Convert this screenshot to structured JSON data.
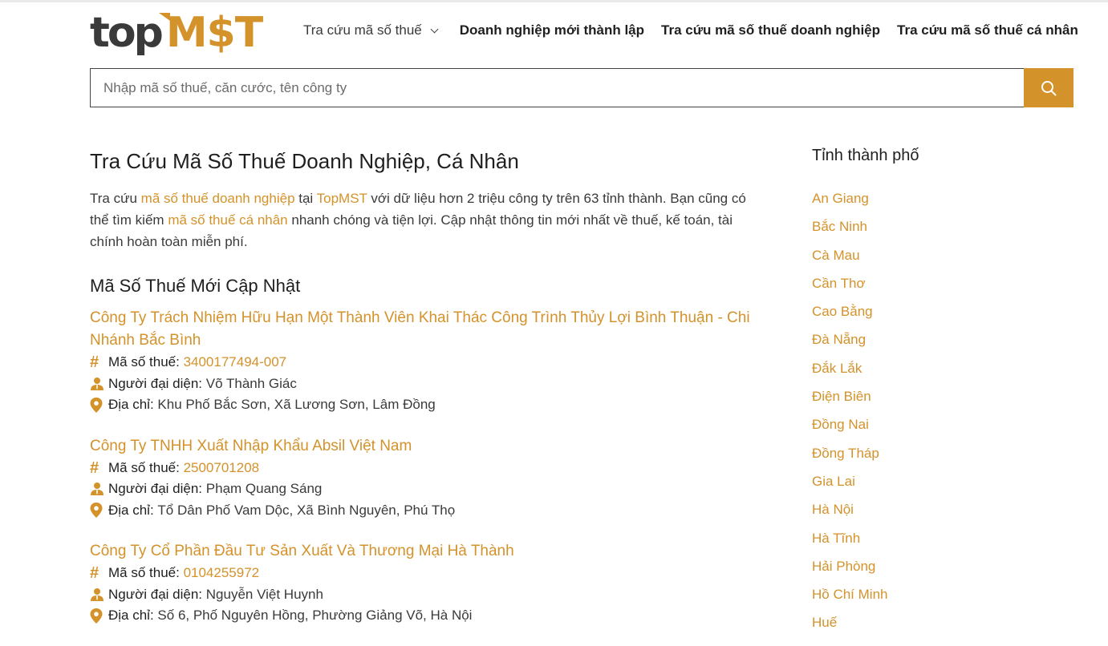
{
  "brand": {
    "logo_top": "top",
    "logo_mst": "M$T",
    "accent_color": "#d4922b"
  },
  "nav": {
    "item1": "Tra cứu mã số thuế",
    "item2": "Doanh nghiệp mới thành lập",
    "item3": "Tra cứu mã số thuế doanh nghiệp",
    "item4": "Tra cứu mã số thuế cá nhân"
  },
  "search": {
    "placeholder": "Nhập mã số thuế, căn cước, tên công ty",
    "icon": "search-icon"
  },
  "main": {
    "title": "Tra Cứu Mã Số Thuế Doanh Nghiệp, Cá Nhân",
    "intro": {
      "p1": "Tra cứu ",
      "link1": "mã số thuế doanh nghiệp",
      "p2": " tại ",
      "link2": "TopMST",
      "p3": " với dữ liệu hơn 2 triệu công ty trên 63 tỉnh thành. Bạn cũng có thể tìm kiếm ",
      "link3": "mã số thuế cá nhân",
      "p4": " nhanh chóng và tiện lợi. Cập nhật thông tin mới nhất về thuế, kế toán, tài chính hoàn toàn miễn phí."
    },
    "section_title": "Mã Số Thuế Mới Cập Nhật",
    "labels": {
      "tax": "Mã số thuế:",
      "rep": "Người đại diện:",
      "addr": "Địa chỉ:"
    },
    "companies": [
      {
        "name": "Công Ty Trách Nhiệm Hữu Hạn Một Thành Viên Khai Thác Công Trình Thủy Lợi Bình Thuận - Chi Nhánh Bắc Bình",
        "tax": "3400177494-007",
        "rep": "Võ Thành Giác",
        "addr": "Khu Phố Bắc Sơn, Xã Lương Sơn, Lâm Đồng"
      },
      {
        "name": "Công Ty TNHH Xuất Nhập Khẩu Absil Việt Nam",
        "tax": "2500701208",
        "rep": "Phạm Quang Sáng",
        "addr": "Tổ Dân Phố Vam Dộc, Xã Bình Nguyên, Phú Thọ"
      },
      {
        "name": "Công Ty Cổ Phần Đầu Tư Sản Xuất Và Thương Mại Hà Thành",
        "tax": "0104255972",
        "rep": "Nguyễn Việt Huynh",
        "addr": "Số 6, Phố Nguyên Hồng, Phường Giảng Võ, Hà Nội"
      }
    ]
  },
  "sidebar": {
    "title": "Tỉnh thành phố",
    "provinces": [
      "An Giang",
      "Bắc Ninh",
      "Cà Mau",
      "Cần Thơ",
      "Cao Bằng",
      "Đà Nẵng",
      "Đắk Lắk",
      "Điện Biên",
      "Đồng Nai",
      "Đồng Tháp",
      "Gia Lai",
      "Hà Nội",
      "Hà Tĩnh",
      "Hải Phòng",
      "Hồ Chí Minh",
      "Huế"
    ]
  }
}
